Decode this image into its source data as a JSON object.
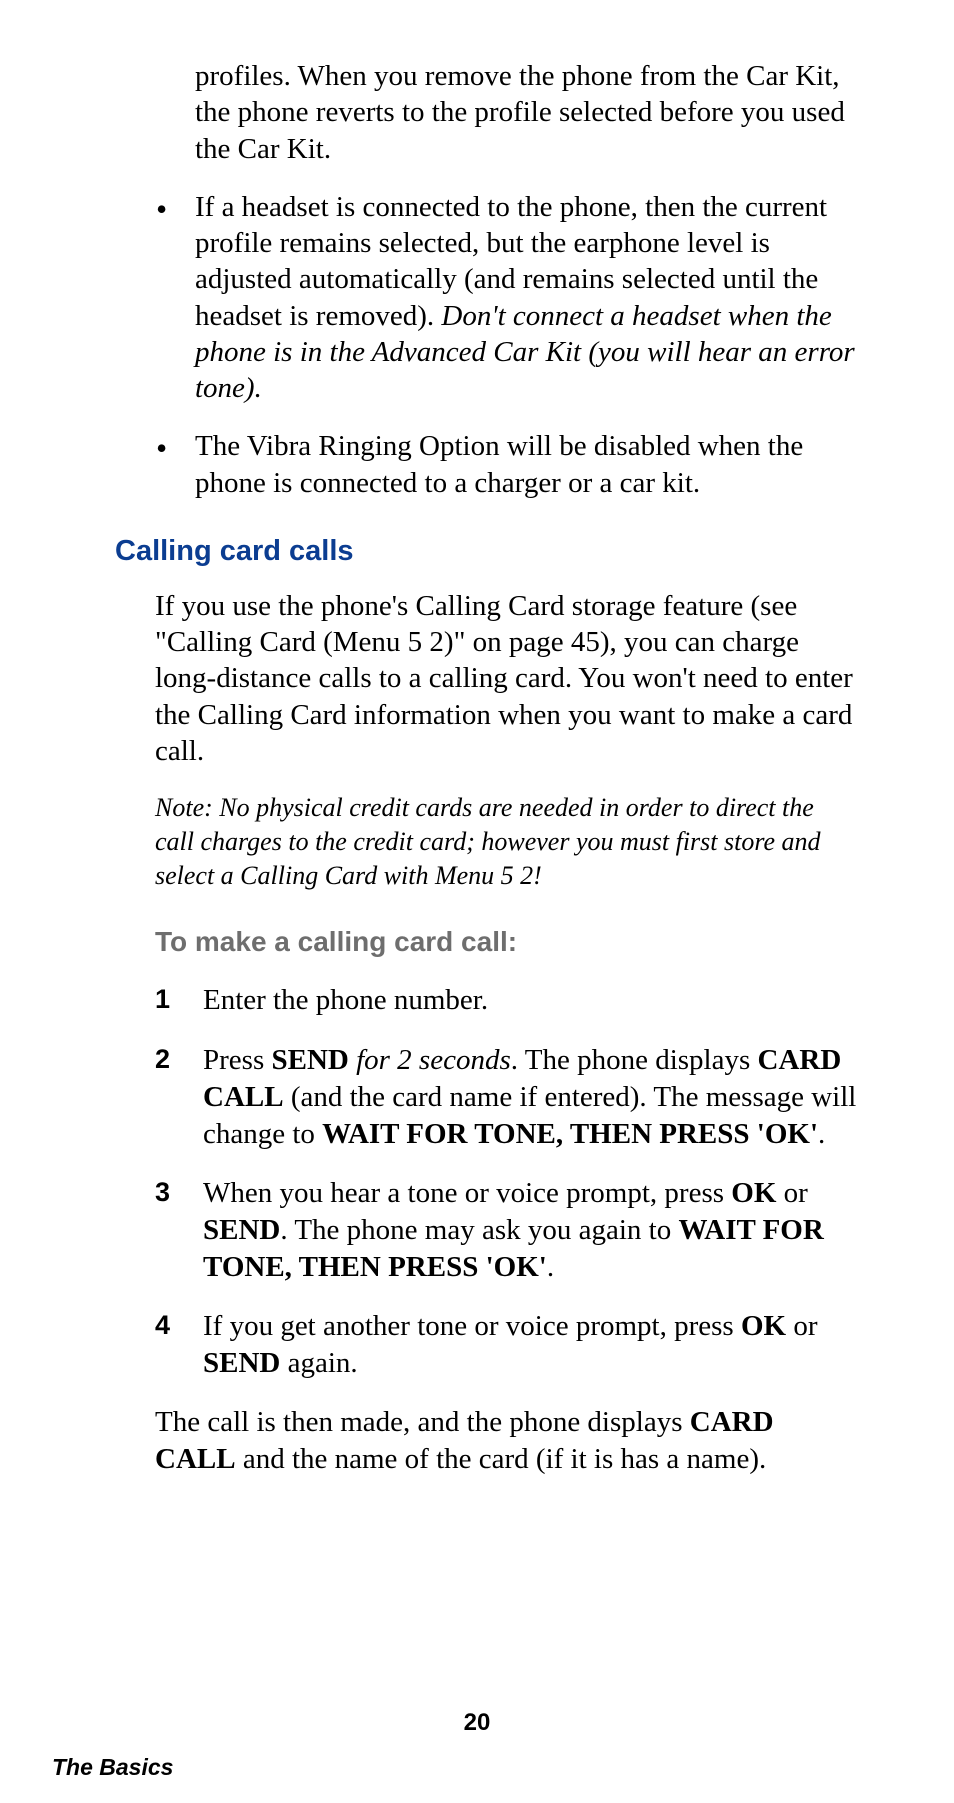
{
  "content": {
    "continued_para": "profiles. When you remove the phone from the Car Kit, the phone reverts to the profile selected before you used the Car Kit.",
    "bullets": {
      "b1_part1": "If a headset is connected to the phone, then the current profile remains selected, but the earphone level is adjusted automatically (and remains selected until the headset is removed). ",
      "b1_italic": "Don't connect a headset when the phone is in the Advanced Car Kit (you will hear an error tone).",
      "b2": "The Vibra Ringing Option will be disabled when the phone is connected to a charger or a car kit."
    },
    "section_heading": "Calling card calls",
    "intro_para": "If you use the phone's Calling Card storage feature (see \"Calling Card (Menu 5 2)\" on page 45), you can charge long-distance calls to a calling card. You won't need to enter the Calling Card information when you want to make a card call.",
    "note": "Note: No physical credit cards are needed in order to direct the call charges to the credit card; however you must first store and select a Calling Card with Menu 5 2!",
    "subheading": "To make a calling card call:",
    "steps": {
      "s1_num": "1",
      "s1": "Enter the phone number.",
      "s2_num": "2",
      "s2_a": "Press ",
      "s2_send": "SEND",
      "s2_b": " ",
      "s2_italic": "for 2 seconds",
      "s2_c": ". The phone displays ",
      "s2_cardcall": "CARD CALL",
      "s2_d": " (and the card name if entered). The message will change to ",
      "s2_wait": "WAIT FOR TONE, THEN PRESS 'OK'",
      "s2_e": ".",
      "s3_num": "3",
      "s3_a": "When you hear a tone or voice prompt, press ",
      "s3_ok": "OK",
      "s3_b": " or ",
      "s3_send": "SEND",
      "s3_c": ". The phone may ask you again to ",
      "s3_wait": "WAIT FOR TONE, THEN PRESS 'OK'",
      "s3_d": ".",
      "s4_num": "4",
      "s4_a": "If you get another tone or voice prompt, press ",
      "s4_ok": "OK",
      "s4_b": " or ",
      "s4_send": "SEND",
      "s4_c": " again."
    },
    "closing_a": "The call is then made, and the phone displays ",
    "closing_cardcall": "CARD CALL",
    "closing_b": " and the name of the card (if it is has a name)."
  },
  "footer": {
    "page_number": "20",
    "section_label": "The Basics"
  }
}
